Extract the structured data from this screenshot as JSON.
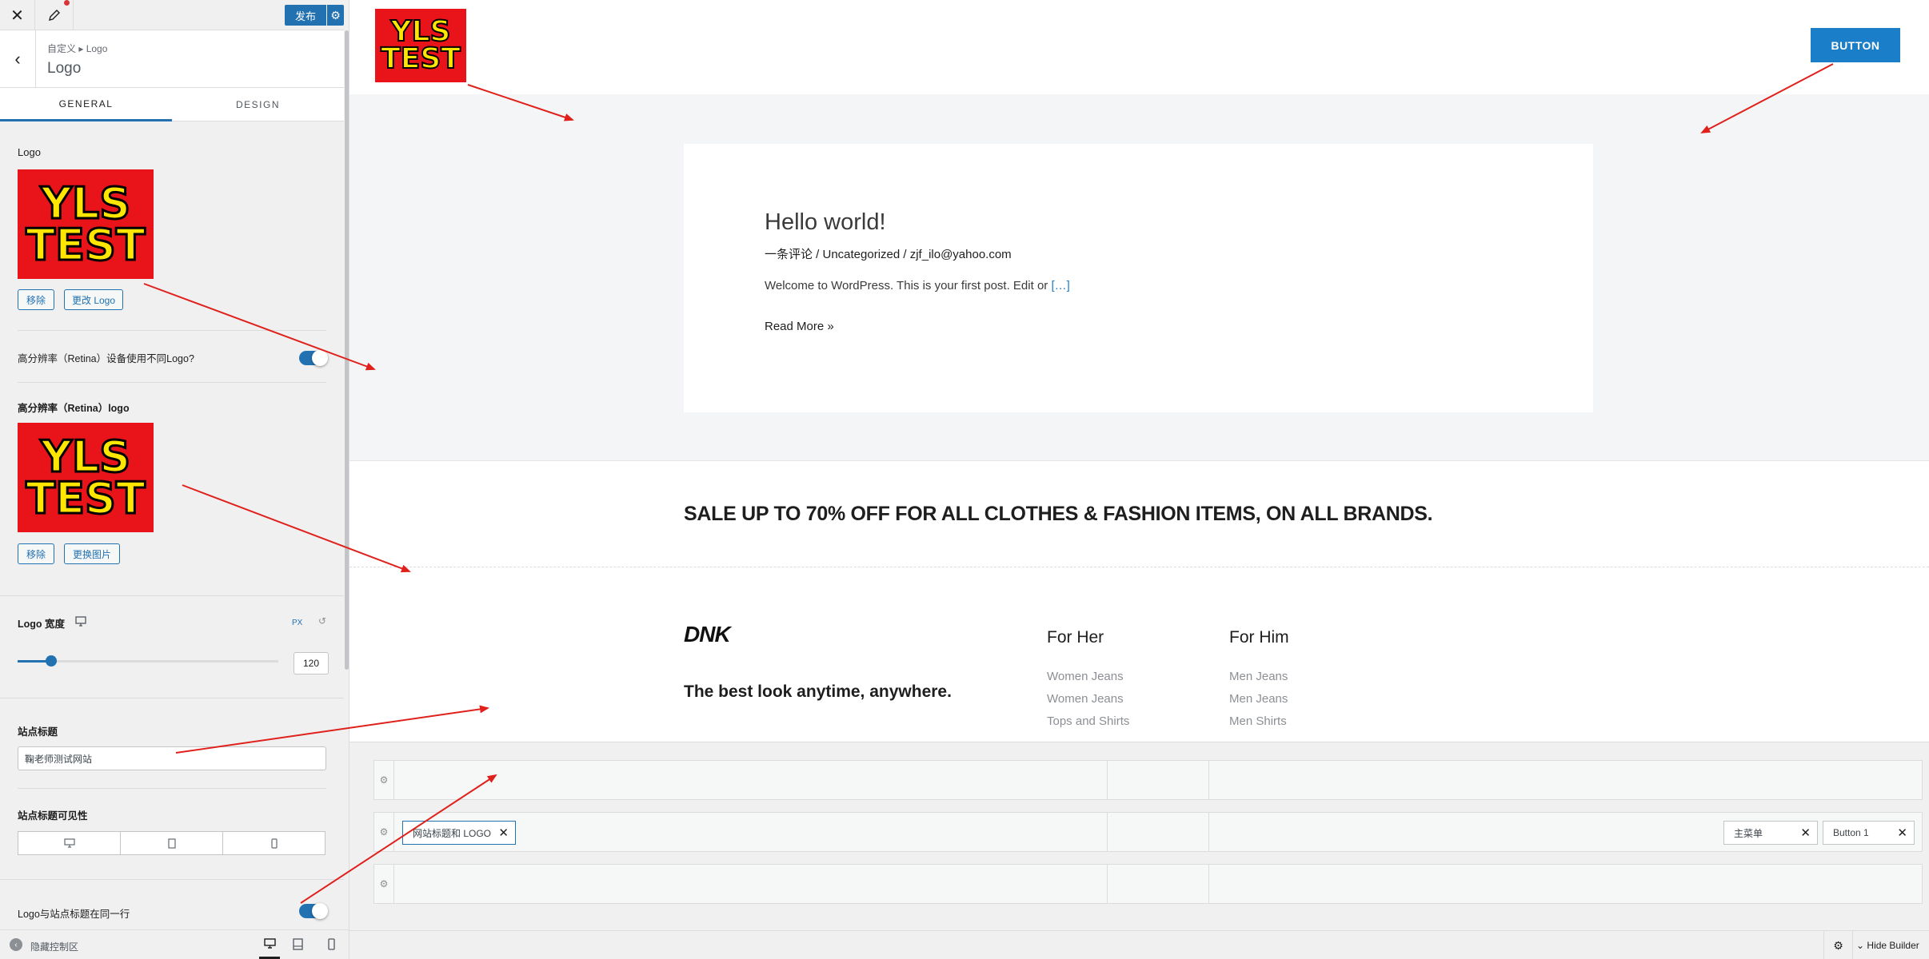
{
  "topbar": {
    "close_icon": "close-icon",
    "publish_label": "发布"
  },
  "breadcrumb": {
    "path": "自定义 ▸ Logo",
    "title": "Logo"
  },
  "tabs": [
    {
      "label": "GENERAL"
    },
    {
      "label": "DESIGN"
    }
  ],
  "logo_section": {
    "title": "Logo",
    "image_text_line1": "YLS",
    "image_text_line2": "TEST",
    "remove_label": "移除",
    "change_label": "更改 Logo"
  },
  "retina_toggle": {
    "label": "高分辨率（Retina）设备使用不同Logo?",
    "checked": true
  },
  "retina_logo": {
    "title": "高分辨率（Retina）logo",
    "remove_label": "移除",
    "change_label": "更换图片"
  },
  "logo_width": {
    "label": "Logo 宽度",
    "unit": "PX",
    "value": "120",
    "slider_fraction": 0.13
  },
  "site_title": {
    "label": "站点标题",
    "value": "鞠老师测试网站"
  },
  "site_title_visibility": {
    "label": "站点标题可见性",
    "devices": [
      "desktop-icon",
      "tablet-icon",
      "mobile-icon"
    ]
  },
  "logo_same_line": {
    "label": "Logo与站点标题在同一行",
    "checked": true
  },
  "bottombar": {
    "hide_controls_label": "隐藏控制区"
  },
  "preview": {
    "header_logo_line1": "YLS",
    "header_logo_line2": "TEST",
    "header_button": "BUTTON",
    "post": {
      "title": "Hello world!",
      "meta": "一条评论 / Uncategorized / zjf_ilo@yahoo.com",
      "excerpt_prefix": "Welcome to WordPress. This is your first post. Edit or ",
      "excerpt_link": "[…]",
      "read_more": "Read More »"
    },
    "banner_text": "SALE UP TO 70% OFF FOR ALL CLOTHES & FASHION ITEMS, ON ALL BRANDS.",
    "footer": {
      "brand": "DNK",
      "tagline": "The best look anytime, anywhere.",
      "col1_title": "For Her",
      "col1_links": [
        "Women Jeans",
        "Women Jeans",
        "Tops and Shirts"
      ],
      "col2_title": "For Him",
      "col2_links": [
        "Men Jeans",
        "Men Jeans",
        "Men Shirts"
      ]
    }
  },
  "builder": {
    "row2_items": [
      "网站标题和 LOGO"
    ],
    "row2_right_items": [
      "主菜单",
      "Button 1"
    ],
    "hide_builder_label": "Hide Builder"
  },
  "colors": {
    "accent": "#2271b1",
    "button": "#1a7ec9",
    "logo_bg": "#e8141a",
    "logo_text": "#ffe600",
    "arrow": "#e0201b"
  }
}
